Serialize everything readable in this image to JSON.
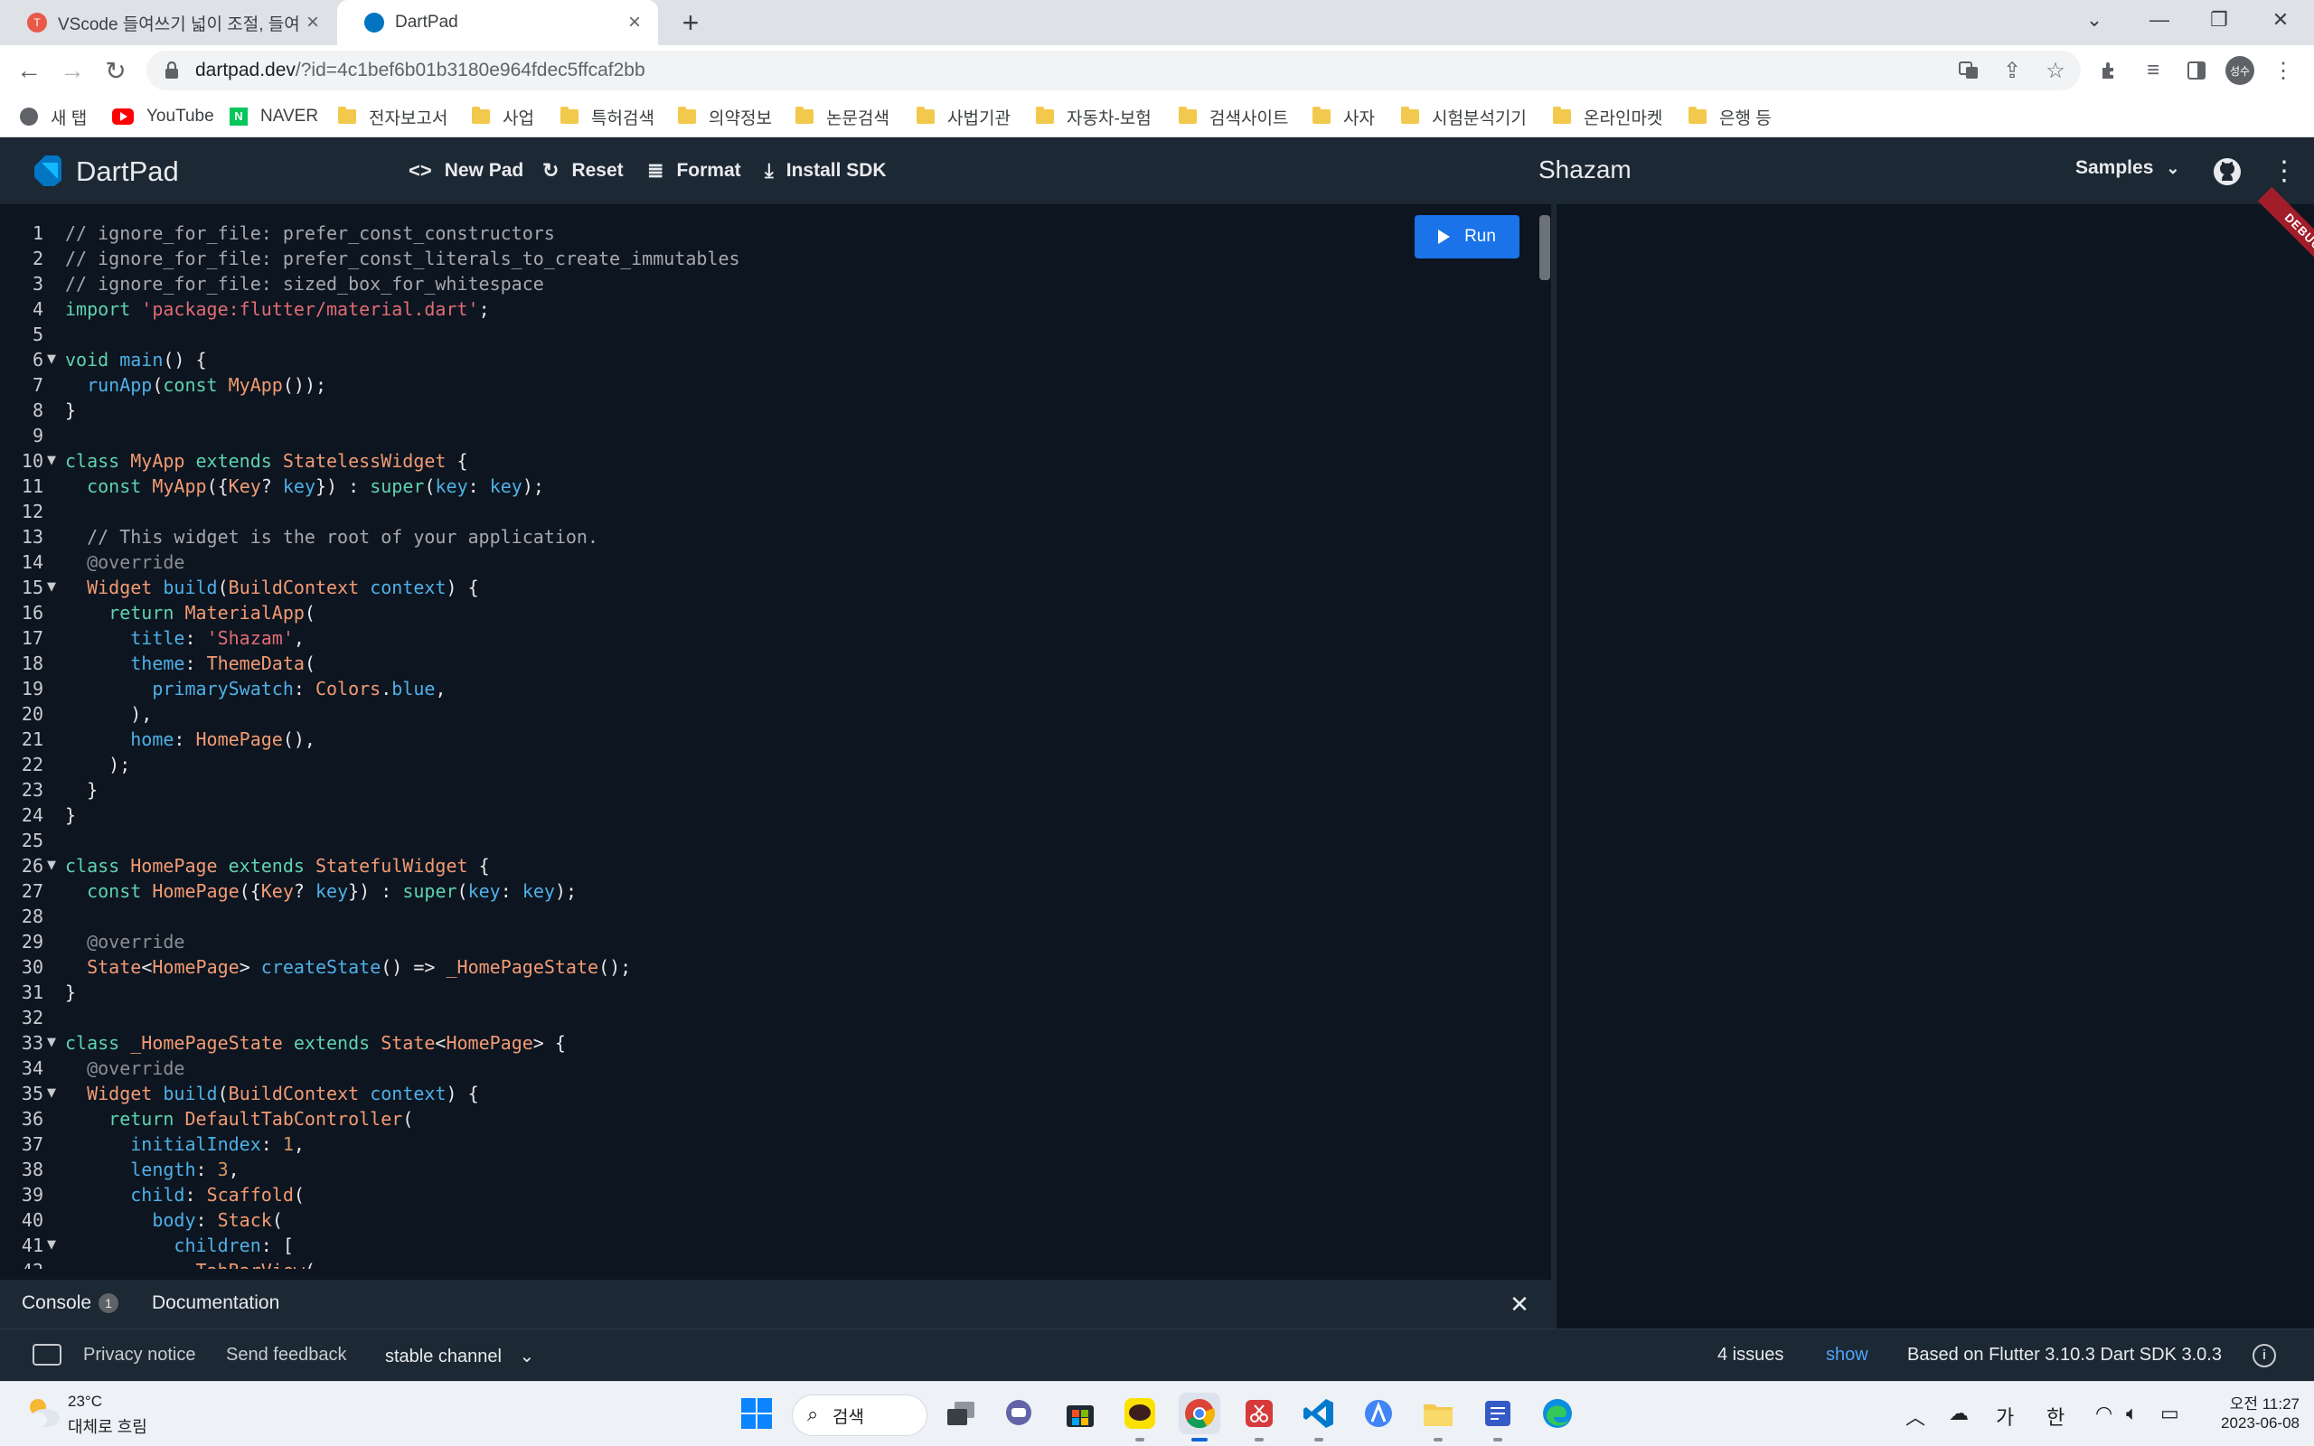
{
  "browser": {
    "tabs": [
      {
        "title": "VScode 들여쓰기 넓이 조절, 들여",
        "active": false
      },
      {
        "title": "DartPad",
        "active": true
      }
    ],
    "url_host": "dartpad.dev",
    "url_rest": "/?id=4c1bef6b01b3180e964fdec5ffcaf2bb",
    "profile_label": "성수",
    "bookmarks": [
      {
        "label": "새 탭",
        "icon": "globe-icon"
      },
      {
        "label": "YouTube",
        "icon": "youtube-icon"
      },
      {
        "label": "NAVER",
        "icon": "naver-icon"
      },
      {
        "label": "전자보고서",
        "icon": "folder-icon"
      },
      {
        "label": "사업",
        "icon": "folder-icon"
      },
      {
        "label": "특허검색",
        "icon": "folder-icon"
      },
      {
        "label": "의약정보",
        "icon": "folder-icon"
      },
      {
        "label": "논문검색",
        "icon": "folder-icon"
      },
      {
        "label": "사법기관",
        "icon": "folder-icon"
      },
      {
        "label": "자동차-보험",
        "icon": "folder-icon"
      },
      {
        "label": "검색사이트",
        "icon": "folder-icon"
      },
      {
        "label": "사자",
        "icon": "folder-icon"
      },
      {
        "label": "시험분석기기",
        "icon": "folder-icon"
      },
      {
        "label": "온라인마켓",
        "icon": "folder-icon"
      },
      {
        "label": "은행 등",
        "icon": "folder-icon"
      }
    ]
  },
  "dartpad": {
    "brand": "DartPad",
    "actions": {
      "new_pad": "New Pad",
      "reset": "Reset",
      "format": "Format",
      "install_sdk": "Install SDK"
    },
    "pad_title": "Shazam",
    "samples_label": "Samples",
    "run_label": "Run",
    "debug_label": "DEBUG"
  },
  "code": [
    [
      [
        "com",
        "// ignore_for_file: prefer_const_constructors"
      ]
    ],
    [
      [
        "com",
        "// ignore_for_file: prefer_const_literals_to_create_immutables"
      ]
    ],
    [
      [
        "com",
        "// ignore_for_file: sized_box_for_whitespace"
      ]
    ],
    [
      [
        "kw",
        "import "
      ],
      [
        "str",
        "'package:flutter/material.dart'"
      ],
      [
        "p",
        ";"
      ]
    ],
    [],
    [
      [
        "kw",
        "void "
      ],
      [
        "fn",
        "main"
      ],
      [
        "p",
        "() {"
      ]
    ],
    [
      [
        "p",
        "  "
      ],
      [
        "fn",
        "runApp"
      ],
      [
        "p",
        "("
      ],
      [
        "kw",
        "const "
      ],
      [
        "cls",
        "MyApp"
      ],
      [
        "p",
        "());"
      ]
    ],
    [
      [
        "p",
        "}"
      ]
    ],
    [],
    [
      [
        "kw",
        "class "
      ],
      [
        "cls",
        "MyApp "
      ],
      [
        "kw",
        "extends "
      ],
      [
        "cls",
        "StatelessWidget"
      ],
      [
        "p",
        " {"
      ]
    ],
    [
      [
        "p",
        "  "
      ],
      [
        "kw",
        "const "
      ],
      [
        "cls",
        "MyApp"
      ],
      [
        "p",
        "({"
      ],
      [
        "cls",
        "Key"
      ],
      [
        "p",
        "? "
      ],
      [
        "prm",
        "key"
      ],
      [
        "p",
        "}) : "
      ],
      [
        "kw",
        "super"
      ],
      [
        "p",
        "("
      ],
      [
        "prm",
        "key"
      ],
      [
        "p",
        ": "
      ],
      [
        "prm",
        "key"
      ],
      [
        "p",
        ");"
      ]
    ],
    [],
    [
      [
        "com",
        "  // This widget is the root of your application."
      ]
    ],
    [
      [
        "ann",
        "  @override"
      ]
    ],
    [
      [
        "p",
        "  "
      ],
      [
        "cls",
        "Widget "
      ],
      [
        "fn",
        "build"
      ],
      [
        "p",
        "("
      ],
      [
        "cls",
        "BuildContext "
      ],
      [
        "prm",
        "context"
      ],
      [
        "p",
        ") {"
      ]
    ],
    [
      [
        "p",
        "    "
      ],
      [
        "kw",
        "return "
      ],
      [
        "cls",
        "MaterialApp"
      ],
      [
        "p",
        "("
      ]
    ],
    [
      [
        "p",
        "      "
      ],
      [
        "prm",
        "title"
      ],
      [
        "p",
        ": "
      ],
      [
        "str",
        "'Shazam'"
      ],
      [
        "p",
        ","
      ]
    ],
    [
      [
        "p",
        "      "
      ],
      [
        "prm",
        "theme"
      ],
      [
        "p",
        ": "
      ],
      [
        "cls",
        "ThemeData"
      ],
      [
        "p",
        "("
      ]
    ],
    [
      [
        "p",
        "        "
      ],
      [
        "prm",
        "primarySwatch"
      ],
      [
        "p",
        ": "
      ],
      [
        "cls",
        "Colors"
      ],
      [
        "p",
        "."
      ],
      [
        "prm",
        "blue"
      ],
      [
        "p",
        ","
      ]
    ],
    [
      [
        "p",
        "      ),"
      ]
    ],
    [
      [
        "p",
        "      "
      ],
      [
        "prm",
        "home"
      ],
      [
        "p",
        ": "
      ],
      [
        "cls",
        "HomePage"
      ],
      [
        "p",
        "(),"
      ]
    ],
    [
      [
        "p",
        "    );"
      ]
    ],
    [
      [
        "p",
        "  }"
      ]
    ],
    [
      [
        "p",
        "}"
      ]
    ],
    [],
    [
      [
        "kw",
        "class "
      ],
      [
        "cls",
        "HomePage "
      ],
      [
        "kw",
        "extends "
      ],
      [
        "cls",
        "StatefulWidget"
      ],
      [
        "p",
        " {"
      ]
    ],
    [
      [
        "p",
        "  "
      ],
      [
        "kw",
        "const "
      ],
      [
        "cls",
        "HomePage"
      ],
      [
        "p",
        "({"
      ],
      [
        "cls",
        "Key"
      ],
      [
        "p",
        "? "
      ],
      [
        "prm",
        "key"
      ],
      [
        "p",
        "}) : "
      ],
      [
        "kw",
        "super"
      ],
      [
        "p",
        "("
      ],
      [
        "prm",
        "key"
      ],
      [
        "p",
        ": "
      ],
      [
        "prm",
        "key"
      ],
      [
        "p",
        ");"
      ]
    ],
    [],
    [
      [
        "ann",
        "  @override"
      ]
    ],
    [
      [
        "p",
        "  "
      ],
      [
        "cls",
        "State"
      ],
      [
        "p",
        "<"
      ],
      [
        "cls",
        "HomePage"
      ],
      [
        "p",
        "> "
      ],
      [
        "fn",
        "createState"
      ],
      [
        "p",
        "() => "
      ],
      [
        "cls",
        "_HomePageState"
      ],
      [
        "p",
        "();"
      ]
    ],
    [
      [
        "p",
        "}"
      ]
    ],
    [],
    [
      [
        "kw",
        "class "
      ],
      [
        "cls",
        "_HomePageState "
      ],
      [
        "kw",
        "extends "
      ],
      [
        "cls",
        "State"
      ],
      [
        "p",
        "<"
      ],
      [
        "cls",
        "HomePage"
      ],
      [
        "p",
        "> {"
      ]
    ],
    [
      [
        "ann",
        "  @override"
      ]
    ],
    [
      [
        "p",
        "  "
      ],
      [
        "cls",
        "Widget "
      ],
      [
        "fn",
        "build"
      ],
      [
        "p",
        "("
      ],
      [
        "cls",
        "BuildContext "
      ],
      [
        "prm",
        "context"
      ],
      [
        "p",
        ") {"
      ]
    ],
    [
      [
        "p",
        "    "
      ],
      [
        "kw",
        "return "
      ],
      [
        "cls",
        "DefaultTabController"
      ],
      [
        "p",
        "("
      ]
    ],
    [
      [
        "p",
        "      "
      ],
      [
        "prm",
        "initialIndex"
      ],
      [
        "p",
        ": "
      ],
      [
        "num",
        "1"
      ],
      [
        "p",
        ","
      ]
    ],
    [
      [
        "p",
        "      "
      ],
      [
        "prm",
        "length"
      ],
      [
        "p",
        ": "
      ],
      [
        "num",
        "3"
      ],
      [
        "p",
        ","
      ]
    ],
    [
      [
        "p",
        "      "
      ],
      [
        "prm",
        "child"
      ],
      [
        "p",
        ": "
      ],
      [
        "cls",
        "Scaffold"
      ],
      [
        "p",
        "("
      ]
    ],
    [
      [
        "p",
        "        "
      ],
      [
        "prm",
        "body"
      ],
      [
        "p",
        ": "
      ],
      [
        "cls",
        "Stack"
      ],
      [
        "p",
        "("
      ]
    ],
    [
      [
        "p",
        "          "
      ],
      [
        "prm",
        "children"
      ],
      [
        "p",
        ": ["
      ]
    ],
    [
      [
        "p",
        "            "
      ],
      [
        "cls",
        "TabBarView"
      ],
      [
        "p",
        "("
      ]
    ]
  ],
  "fold_lines": [
    6,
    10,
    15,
    26,
    33,
    35,
    41
  ],
  "console": {
    "tab_console": "Console",
    "console_count": "1",
    "tab_docs": "Documentation"
  },
  "status": {
    "privacy": "Privacy notice",
    "feedback": "Send feedback",
    "channel": "stable channel",
    "issues": "4 issues",
    "show": "show",
    "sdk": "Based on Flutter 3.10.3 Dart SDK 3.0.3"
  },
  "taskbar": {
    "temp": "23°C",
    "weather": "대체로 흐림",
    "search": "검색",
    "ime1": "가",
    "ime2": "한",
    "time": "오전 11:27",
    "date": "2023-06-08"
  }
}
